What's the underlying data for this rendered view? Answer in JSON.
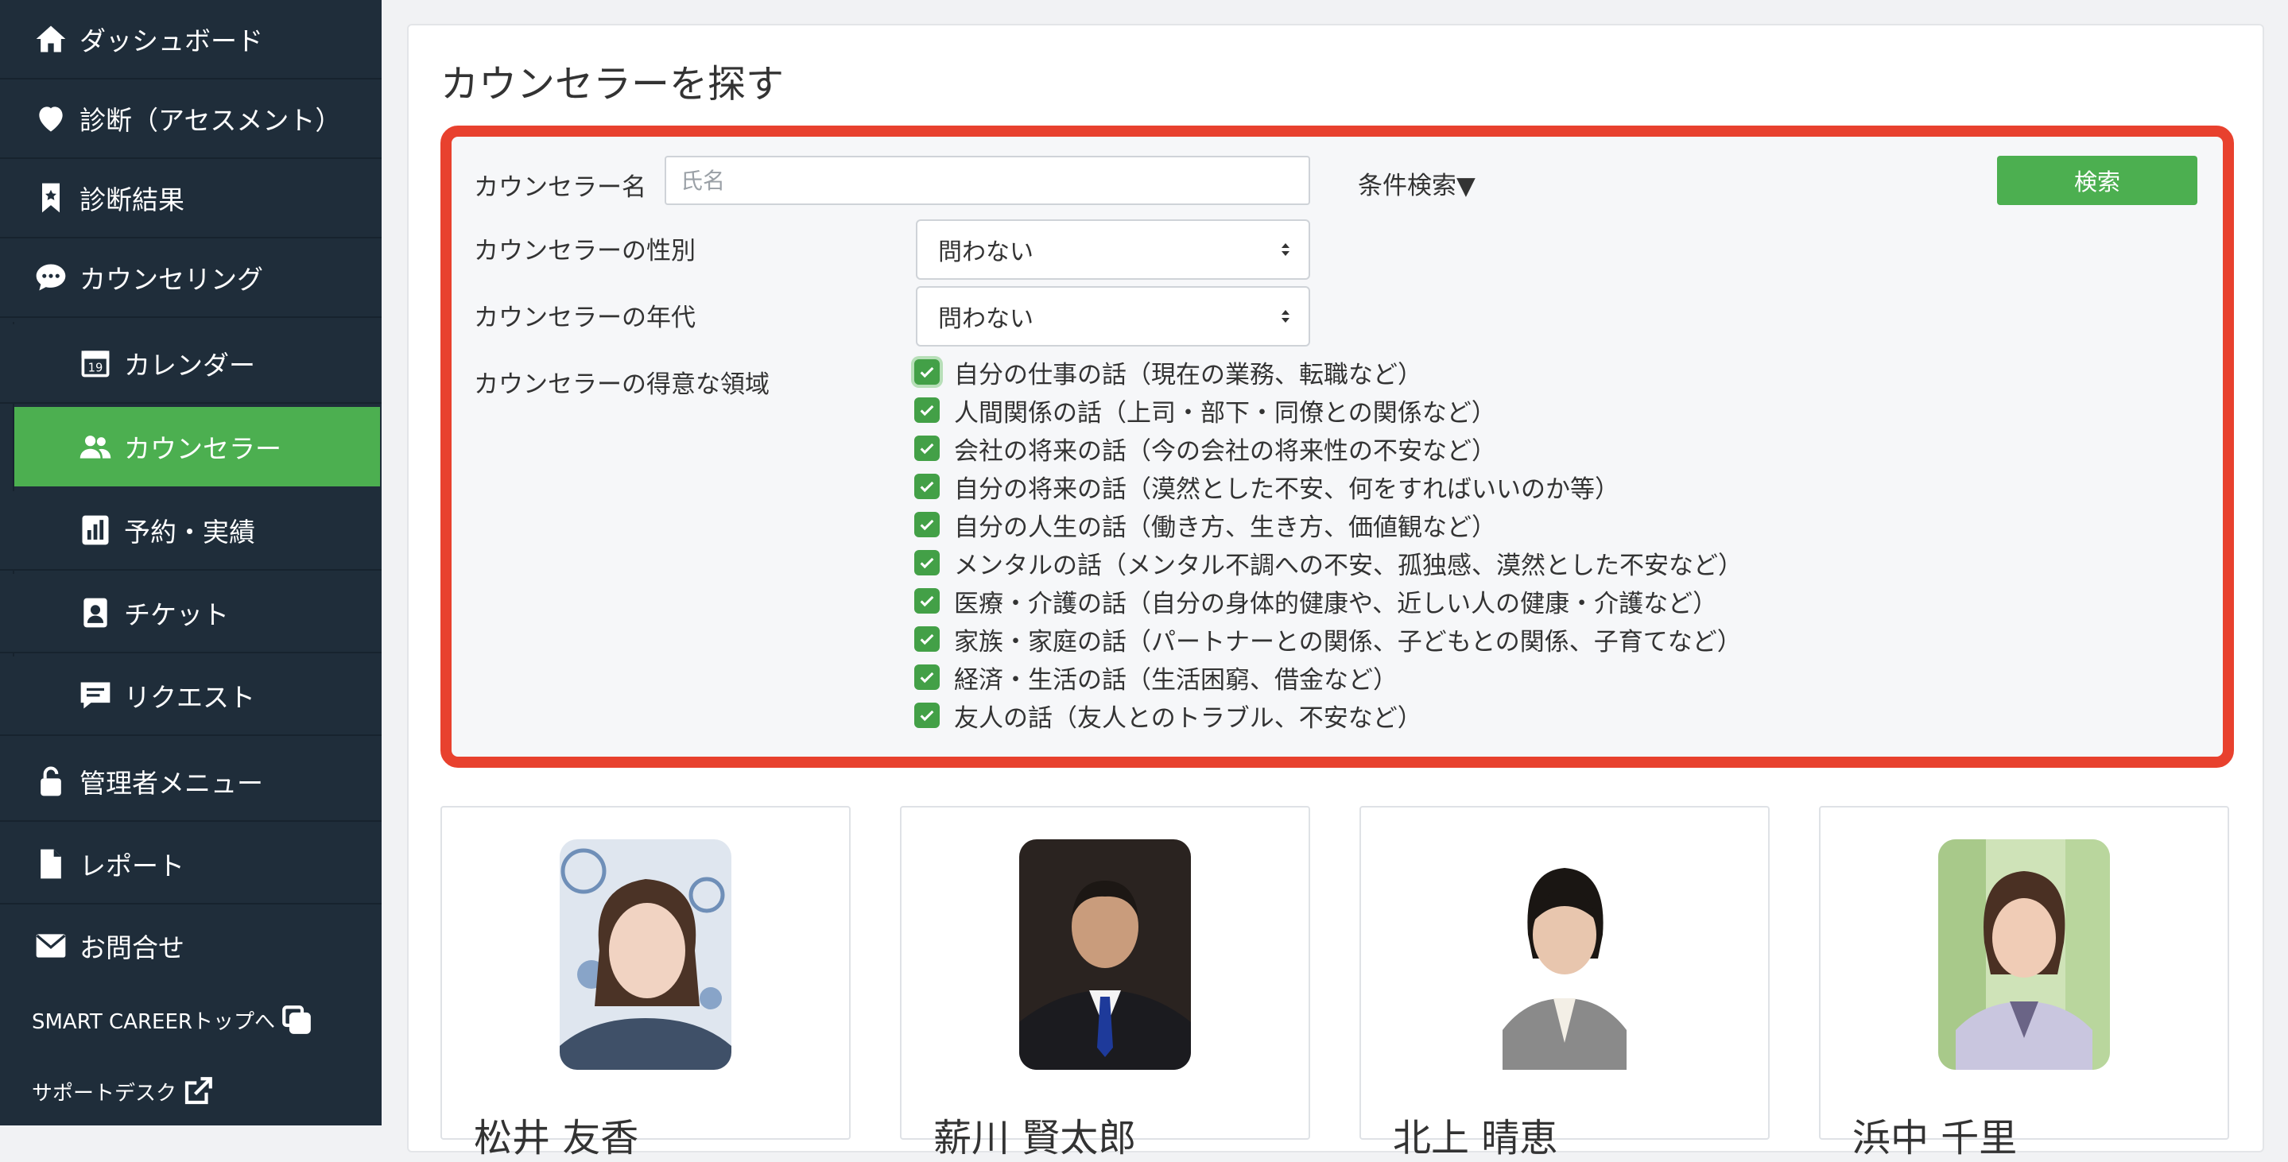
{
  "sidebar": {
    "items": [
      {
        "label": "ダッシュボード",
        "icon": "home-icon"
      },
      {
        "label": "診断（アセスメント）",
        "icon": "heart-icon"
      },
      {
        "label": "診断結果",
        "icon": "bookmark-icon"
      },
      {
        "label": "カウンセリング",
        "icon": "chat-bubble-icon"
      }
    ],
    "sub_items": [
      {
        "label": "カレンダー",
        "icon": "calendar-icon",
        "icon_text": "19"
      },
      {
        "label": "カウンセラー",
        "icon": "users-icon",
        "active": true
      },
      {
        "label": "予約・実績",
        "icon": "bar-chart-icon"
      },
      {
        "label": "チケット",
        "icon": "id-badge-icon"
      },
      {
        "label": "リクエスト",
        "icon": "comment-icon"
      }
    ],
    "lower_items": [
      {
        "label": "管理者メニュー",
        "icon": "lock-icon"
      },
      {
        "label": "レポート",
        "icon": "file-icon"
      },
      {
        "label": "お問合せ",
        "icon": "envelope-icon"
      }
    ],
    "links": [
      {
        "label": "SMART CAREERトップへ",
        "icon": "window-copy-icon"
      },
      {
        "label": "サポートデスク",
        "icon": "external-link-icon"
      }
    ],
    "colors": {
      "background": "#1f2d3a",
      "active": "#4caf50"
    }
  },
  "main": {
    "title": "カウンセラーを探す",
    "search": {
      "name_label": "カウンセラー名",
      "name_placeholder": "氏名",
      "name_value": "",
      "condition_toggle": "条件検索▼",
      "button_label": "検索",
      "gender_label": "カウンセラーの性別",
      "gender_value": "問わない",
      "age_label": "カウンセラーの年代",
      "age_value": "問わない",
      "domain_label": "カウンセラーの得意な領域",
      "domains": [
        {
          "label": "自分の仕事の話（現在の業務、転職など）",
          "checked": true
        },
        {
          "label": "人間関係の話（上司・部下・同僚との関係など）",
          "checked": true
        },
        {
          "label": "会社の将来の話（今の会社の将来性の不安など）",
          "checked": true
        },
        {
          "label": "自分の将来の話（漠然とした不安、何をすればいいのか等）",
          "checked": true
        },
        {
          "label": "自分の人生の話（働き方、生き方、価値観など）",
          "checked": true
        },
        {
          "label": "メンタルの話（メンタル不調への不安、孤独感、漠然とした不安など）",
          "checked": true
        },
        {
          "label": "医療・介護の話（自分の身体的健康や、近しい人の健康・介護など）",
          "checked": true
        },
        {
          "label": "家族・家庭の話（パートナーとの関係、子どもとの関係、子育てなど）",
          "checked": true
        },
        {
          "label": "経済・生活の話（生活困窮、借金など）",
          "checked": true
        },
        {
          "label": "友人の話（友人とのトラブル、不安など）",
          "checked": true
        }
      ],
      "highlight_color": "#e8412e",
      "accent_color": "#43a047"
    },
    "counselors": [
      {
        "name": "松井 友香"
      },
      {
        "name": "薪川 賢太郎"
      },
      {
        "name": "北上 晴恵"
      },
      {
        "name": "浜中 千里"
      }
    ]
  }
}
